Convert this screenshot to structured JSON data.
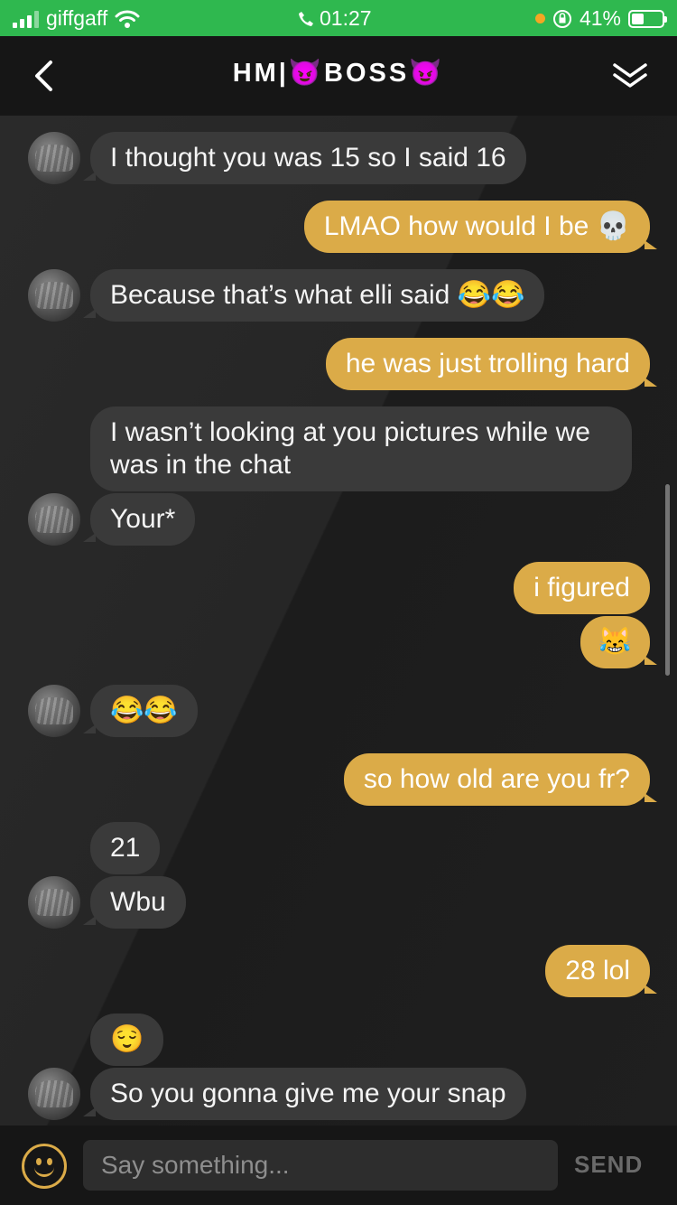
{
  "status_bar": {
    "carrier": "giffgaff",
    "time": "01:27",
    "battery": "41%",
    "battery_level": 0.41,
    "background_color": "#2fb84f"
  },
  "header": {
    "title": "HM|😈BOSS😈",
    "back_icon": "chevron-left-icon",
    "collapse_icon": "double-chevron-down-icon"
  },
  "messages": [
    {
      "sender": "them",
      "text": "I thought you was 15 so I said 16"
    },
    {
      "sender": "me",
      "text": "LMAO how would I be 💀"
    },
    {
      "sender": "them",
      "text": "Because that’s what elli said 😂😂"
    },
    {
      "sender": "me",
      "text": "he was just trolling hard"
    },
    {
      "sender": "them",
      "text": "I wasn’t looking at you pictures while we was in the chat"
    },
    {
      "sender": "them",
      "text": "Your*"
    },
    {
      "sender": "me",
      "text": "i figured"
    },
    {
      "sender": "me",
      "text": "😹"
    },
    {
      "sender": "them",
      "text": "😂😂"
    },
    {
      "sender": "me",
      "text": "so how old are you fr?"
    },
    {
      "sender": "them",
      "text": "21"
    },
    {
      "sender": "them",
      "text": "Wbu"
    },
    {
      "sender": "me",
      "text": "28 lol"
    },
    {
      "sender": "them",
      "text": "😌"
    },
    {
      "sender": "them",
      "text": "So you gonna give me your snap"
    }
  ],
  "composer": {
    "placeholder": "Say something...",
    "value": "",
    "send_label": "SEND",
    "emoji_icon": "smiley-icon"
  },
  "colors": {
    "my_bubble": "#dbab48",
    "their_bubble": "#3a3a3a",
    "accent": "#dbab48"
  }
}
